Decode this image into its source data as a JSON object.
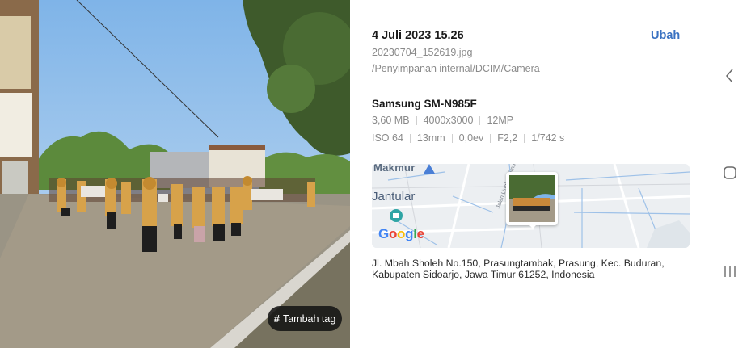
{
  "photo": {
    "tag_button_label": "Tambah tag",
    "tag_icon": "#"
  },
  "details": {
    "date_time": "4 Juli 2023 15.26",
    "edit_label": "Ubah",
    "filename": "20230704_152619.jpg",
    "filepath": "/Penyimpanan internal/DCIM/Camera",
    "device_name": "Samsung SM-N985F",
    "specs_row1": [
      "3,60 MB",
      "4000x3000",
      "12MP"
    ],
    "specs_row2": [
      "ISO 64",
      "13mm",
      "0,0ev",
      "F2,2",
      "1/742 s"
    ]
  },
  "map": {
    "label_top": "Makmur",
    "label_left": "Jantular",
    "road_label": "Jalan Lingkar Timur",
    "logo_letters": [
      {
        "ch": "G",
        "color": "#4285F4"
      },
      {
        "ch": "o",
        "color": "#EA4335"
      },
      {
        "ch": "o",
        "color": "#FBBC05"
      },
      {
        "ch": "g",
        "color": "#4285F4"
      },
      {
        "ch": "l",
        "color": "#34A853"
      },
      {
        "ch": "e",
        "color": "#EA4335"
      }
    ]
  },
  "address": "Jl. Mbah Sholeh No.150, Prasungtambak, Prasung, Kec. Buduran, Kabupaten Sidoarjo, Jawa Timur 61252, Indonesia",
  "navigation": {
    "back_icon": "chevron-left-icon",
    "home_icon": "rounded-square-icon",
    "recents_icon": "three-bars-icon"
  },
  "colors": {
    "accent": "#3a72c2",
    "primary_text": "#1a1a1a",
    "secondary_text": "#8a8a8a"
  }
}
